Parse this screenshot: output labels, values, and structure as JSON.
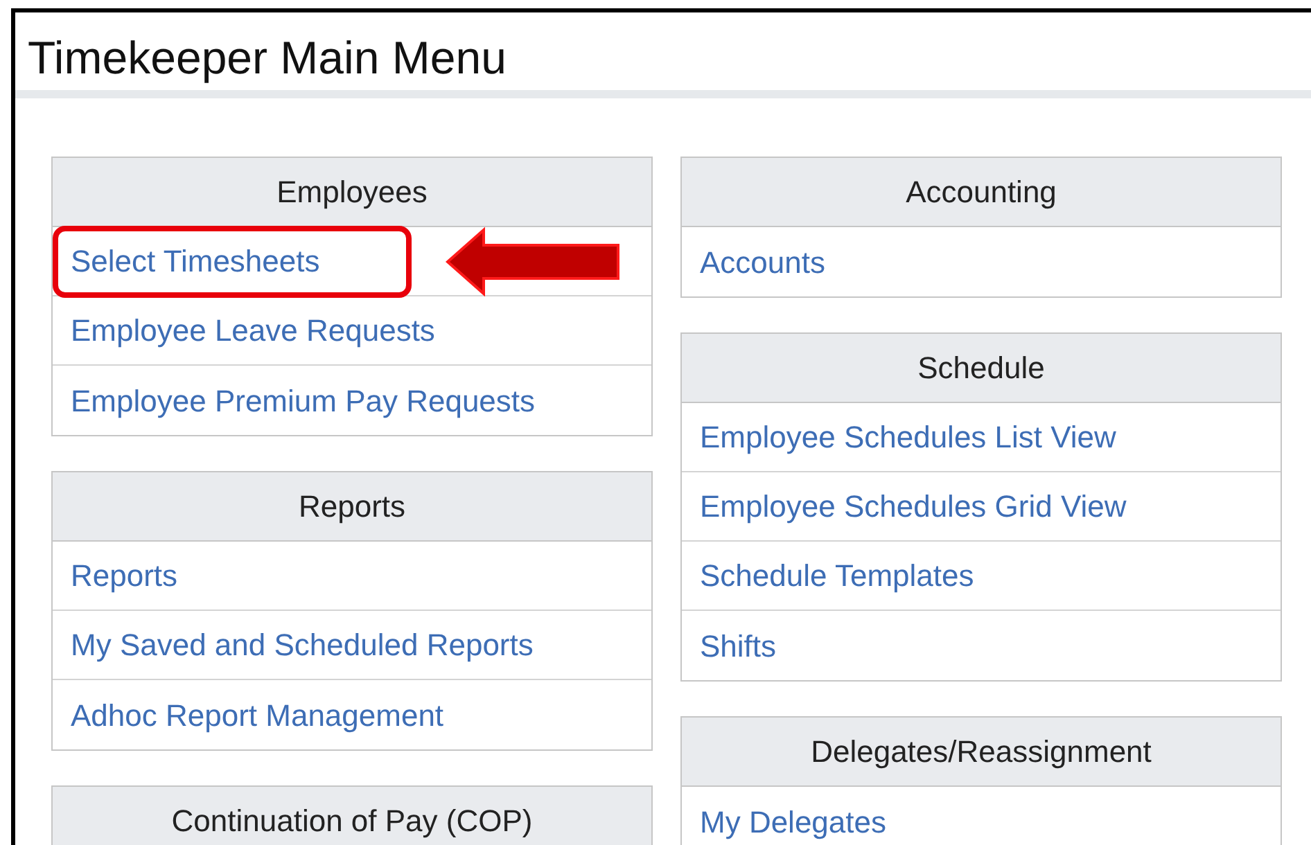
{
  "window": {
    "title": "Timekeeper Main Menu"
  },
  "columns": [
    {
      "sections": [
        {
          "title": "Employees",
          "items": [
            {
              "label": "Select Timesheets",
              "highlighted": true
            },
            {
              "label": "Employee Leave Requests",
              "highlighted": false
            },
            {
              "label": "Employee Premium Pay Requests",
              "highlighted": false
            }
          ]
        },
        {
          "title": "Reports",
          "items": [
            {
              "label": "Reports",
              "highlighted": false
            },
            {
              "label": "My Saved and Scheduled Reports",
              "highlighted": false
            },
            {
              "label": "Adhoc Report Management",
              "highlighted": false
            }
          ]
        },
        {
          "title": "Continuation of Pay (COP)"
        }
      ]
    },
    {
      "sections": [
        {
          "title": "Accounting",
          "items": [
            {
              "label": "Accounts",
              "highlighted": false
            }
          ]
        },
        {
          "title": "Schedule",
          "items": [
            {
              "label": "Employee Schedules List View",
              "highlighted": false
            },
            {
              "label": "Employee Schedules Grid View",
              "highlighted": false
            },
            {
              "label": "Schedule Templates",
              "highlighted": false
            },
            {
              "label": "Shifts",
              "highlighted": false
            }
          ]
        },
        {
          "title": "Delegates/Reassignment",
          "items": [
            {
              "label": "My Delegates",
              "highlighted": false
            }
          ]
        }
      ]
    }
  ]
}
